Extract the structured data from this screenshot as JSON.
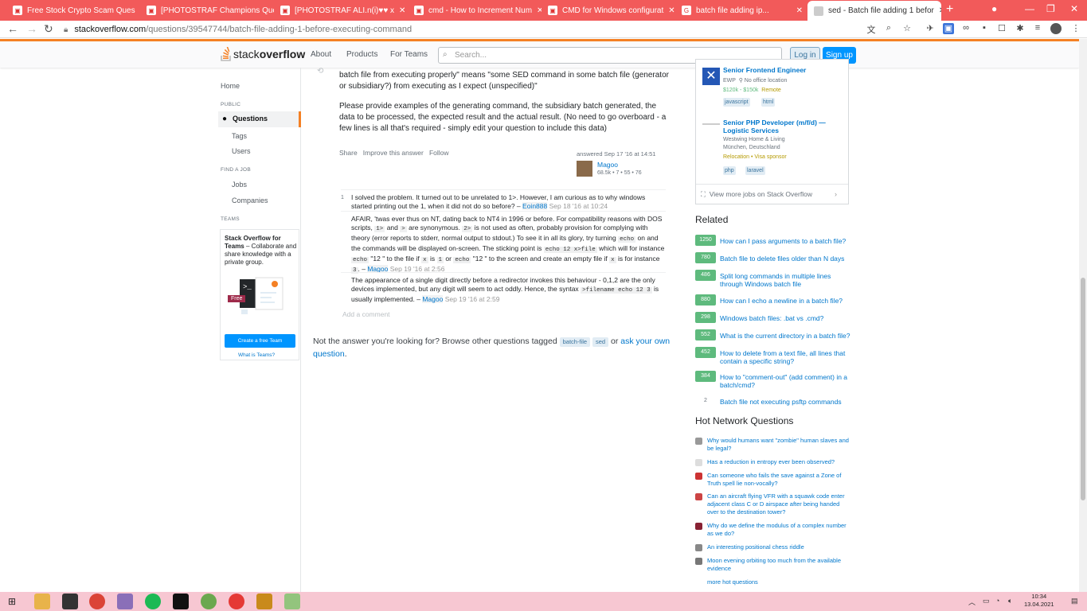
{
  "browser": {
    "tabs": [
      {
        "title": "Free Stock Crypto Scam Ques"
      },
      {
        "title": "[PHOTOSTRAF Champions Quest"
      },
      {
        "title": "[PHOTOSTRAF ALI.n(i)♥♥ x"
      },
      {
        "title": "cmd - How to Increment Num"
      },
      {
        "title": "CMD for Windows configurat"
      },
      {
        "title": "batch file adding ip..."
      },
      {
        "title": "sed - Batch file adding 1 befor"
      }
    ],
    "url_host": "stackoverflow.com",
    "url_path": "/questions/39547744/batch-file-adding-1-before-executing-command"
  },
  "header": {
    "logo_stack": "stack",
    "logo_overflow": "overflow",
    "nav": [
      "About",
      "Products",
      "For Teams"
    ],
    "search_placeholder": "Search...",
    "login": "Log in",
    "signup": "Sign up"
  },
  "leftnav": {
    "home": "Home",
    "public": "PUBLIC",
    "questions": "Questions",
    "tags": "Tags",
    "users": "Users",
    "find_a_job": "FIND A JOB",
    "jobs": "Jobs",
    "companies": "Companies",
    "teams_head": "TEAMS",
    "teams_title": "Stack Overflow for Teams",
    "teams_desc": " – Collaborate and share knowledge with a private group.",
    "teams_badge": "Free",
    "teams_btn": "Create a free Team",
    "teams_link": "What is Teams?"
  },
  "answer": {
    "p1_tail": "batch file from executing properly\" means \"some SED command in some batch file (generator or subsidiary?) from executing as I expect (unspecified)\"",
    "p2": "Please provide examples of the generating command, the subsidiary batch generated, the data to be processed, the expected result and the actual result. (No need to go overboard - a few lines is all that's required - simply edit your question to include this data)",
    "share": "Share",
    "improve": "Improve this answer",
    "follow": "Follow",
    "answered": "answered Sep 17 '16 at 14:51",
    "user": "Magoo",
    "rep": "68.5k • 7 • 55 • 76"
  },
  "comments": [
    {
      "score": "1",
      "text": "I solved the problem. It turned out to be unrelated to 1>. However, I am curious as to why windows started printing out the 1, when it did not do so before? –",
      "user": "Eoin888",
      "time": "Sep 18 '16 at 10:24"
    },
    {
      "p1": "AFAIR, 'twas ever thus on NT, dating back to NT4 in 1996 or before. For compatibility reasons with DOS scripts,",
      "c1": "1>",
      "p2": "and",
      "c2": ">",
      "p3": "are synonymous.",
      "c3": "2>",
      "p4": "is not used as often, probably provision for complying with theory (error reports to stderr, normal output to stdout.) To see it in all its glory, try turning",
      "c4": "echo",
      "p5": "on and the commands will be displayed on-screen. The sticking point is",
      "c5": "echo 12 x>file",
      "p6": "which will for instance",
      "c6": "echo",
      "p7": "\"12 \" to the file if",
      "c7": "x",
      "p8": "is",
      "c8": "1",
      "p9": "or",
      "c9": "echo",
      "p10": "\"12 \" to the screen and create an empty file if",
      "c10": "x",
      "p11": "is for instance",
      "c11": "3",
      "p12": ". –",
      "user": "Magoo",
      "time": "Sep 19 '16 at 2:56"
    },
    {
      "p1": "The appearance of a single digit directly before a redirector invokes this behaviour - 0,1,2 are the only devices implemented, but any digit will seem to act oddly. Hence, the syntax",
      "c1": ">filename echo 12 3",
      "p2": "is usually implemented. –",
      "user": "Magoo",
      "time": "Sep 19 '16 at 2:59"
    }
  ],
  "add_comment": "Add a comment",
  "not_answer": {
    "t1": "Not the answer you're looking for? Browse other questions tagged",
    "tag1": "batch-file",
    "tag2": "sed",
    "t2": "or",
    "link": "ask your own question",
    "t3": "."
  },
  "jobs": [
    {
      "title": "Senior Frontend Engineer",
      "company": "EWP",
      "location": "No office location",
      "salary": "$120k - $150k",
      "remote": "Remote",
      "tags": [
        "javascript",
        "html"
      ]
    },
    {
      "title": "Senior PHP Developer (m/f/d) — Logistic Services",
      "company": "Westwing Home & Living",
      "location": "München, Deutschland",
      "extra": "Relocation • Visa sponsor",
      "tags": [
        "php",
        "laravel"
      ]
    }
  ],
  "view_more_jobs": "View more jobs on Stack Overflow",
  "related_title": "Related",
  "related": [
    {
      "count": "1250",
      "title": "How can I pass arguments to a batch file?"
    },
    {
      "count": "780",
      "title": "Batch file to delete files older than N days"
    },
    {
      "count": "486",
      "title": "Split long commands in multiple lines through Windows batch file"
    },
    {
      "count": "880",
      "title": "How can I echo a newline in a batch file?"
    },
    {
      "count": "298",
      "title": "Windows batch files: .bat vs .cmd?"
    },
    {
      "count": "552",
      "title": "What is the current directory in a batch file?"
    },
    {
      "count": "452",
      "title": "How to delete from a text file, all lines that contain a specific string?"
    },
    {
      "count": "384",
      "title": "How to \"comment-out\" (add comment) in a batch/cmd?"
    },
    {
      "count": "2",
      "title": "Batch file not executing psftp commands"
    }
  ],
  "hnq_title": "Hot Network Questions",
  "hnq": [
    {
      "title": "Why would humans want \"zombie\" human slaves and be legal?",
      "color": "#999999"
    },
    {
      "title": "Has a reduction in entropy ever been observed?",
      "color": "#dddddd"
    },
    {
      "title": "Can someone who fails the save against a Zone of Truth spell lie non-vocally?",
      "color": "#cc3333"
    },
    {
      "title": "Can an aircraft flying VFR with a squawk code enter adjacent class C or D airspace after being handed over to the destination tower?",
      "color": "#cc4444"
    },
    {
      "title": "Why do we define the modulus of a complex number as we do?",
      "color": "#882233"
    },
    {
      "title": "An interesting positional chess riddle",
      "color": "#888888"
    },
    {
      "title": "Moon evening orbiting too much from the available evidence",
      "color": "#777777"
    }
  ],
  "more_hot": "more hot questions",
  "taskbar": {
    "time": "10:34",
    "date": "13.04.2021"
  }
}
